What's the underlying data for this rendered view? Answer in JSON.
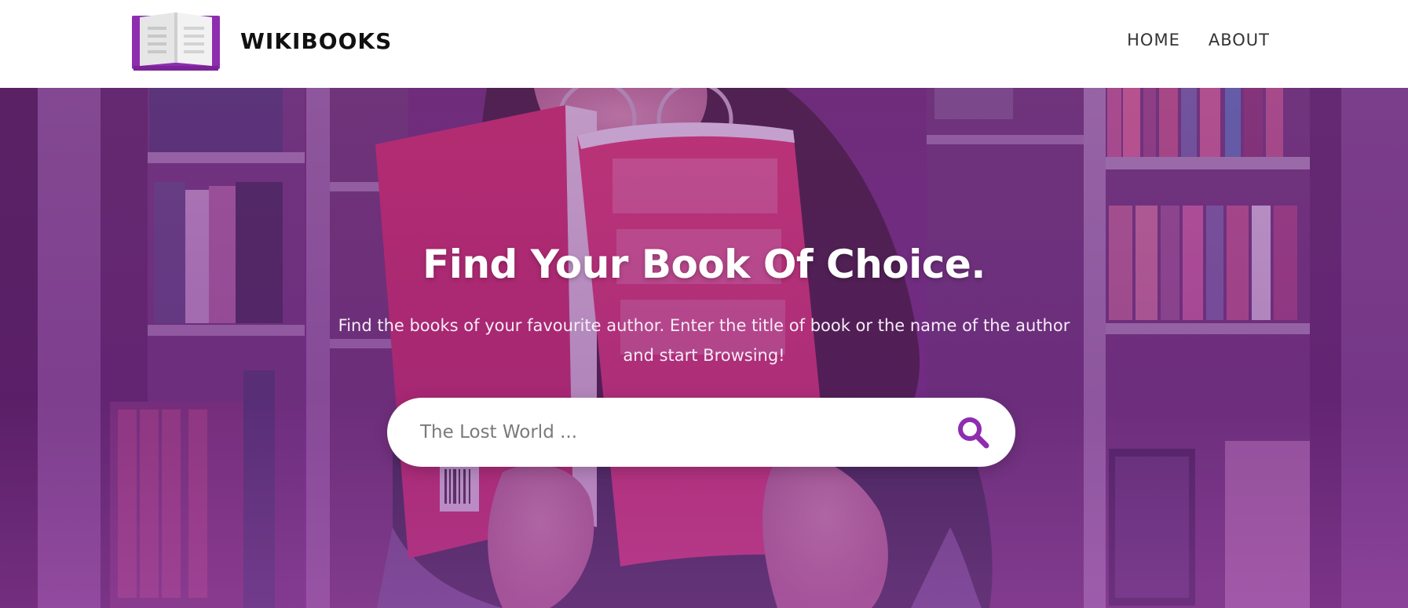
{
  "brand": {
    "name": "WIKIBOOKS",
    "logo_icon": "open-book-icon"
  },
  "nav": {
    "items": [
      {
        "label": "HOME"
      },
      {
        "label": "ABOUT"
      }
    ]
  },
  "hero": {
    "title": "Find Your Book Of Choice.",
    "subtitle": "Find the books of your favourite author. Enter the title of book or the name of the author and start Browsing!",
    "background_icon": "woman-reading-book-in-library-photo"
  },
  "search": {
    "placeholder": "The Lost World ...",
    "value": "",
    "button_icon": "search-icon"
  },
  "colors": {
    "accent": "#8e2db0",
    "overlay": "#7a2a96",
    "header_bg": "#ffffff",
    "brand_text": "#111111"
  }
}
